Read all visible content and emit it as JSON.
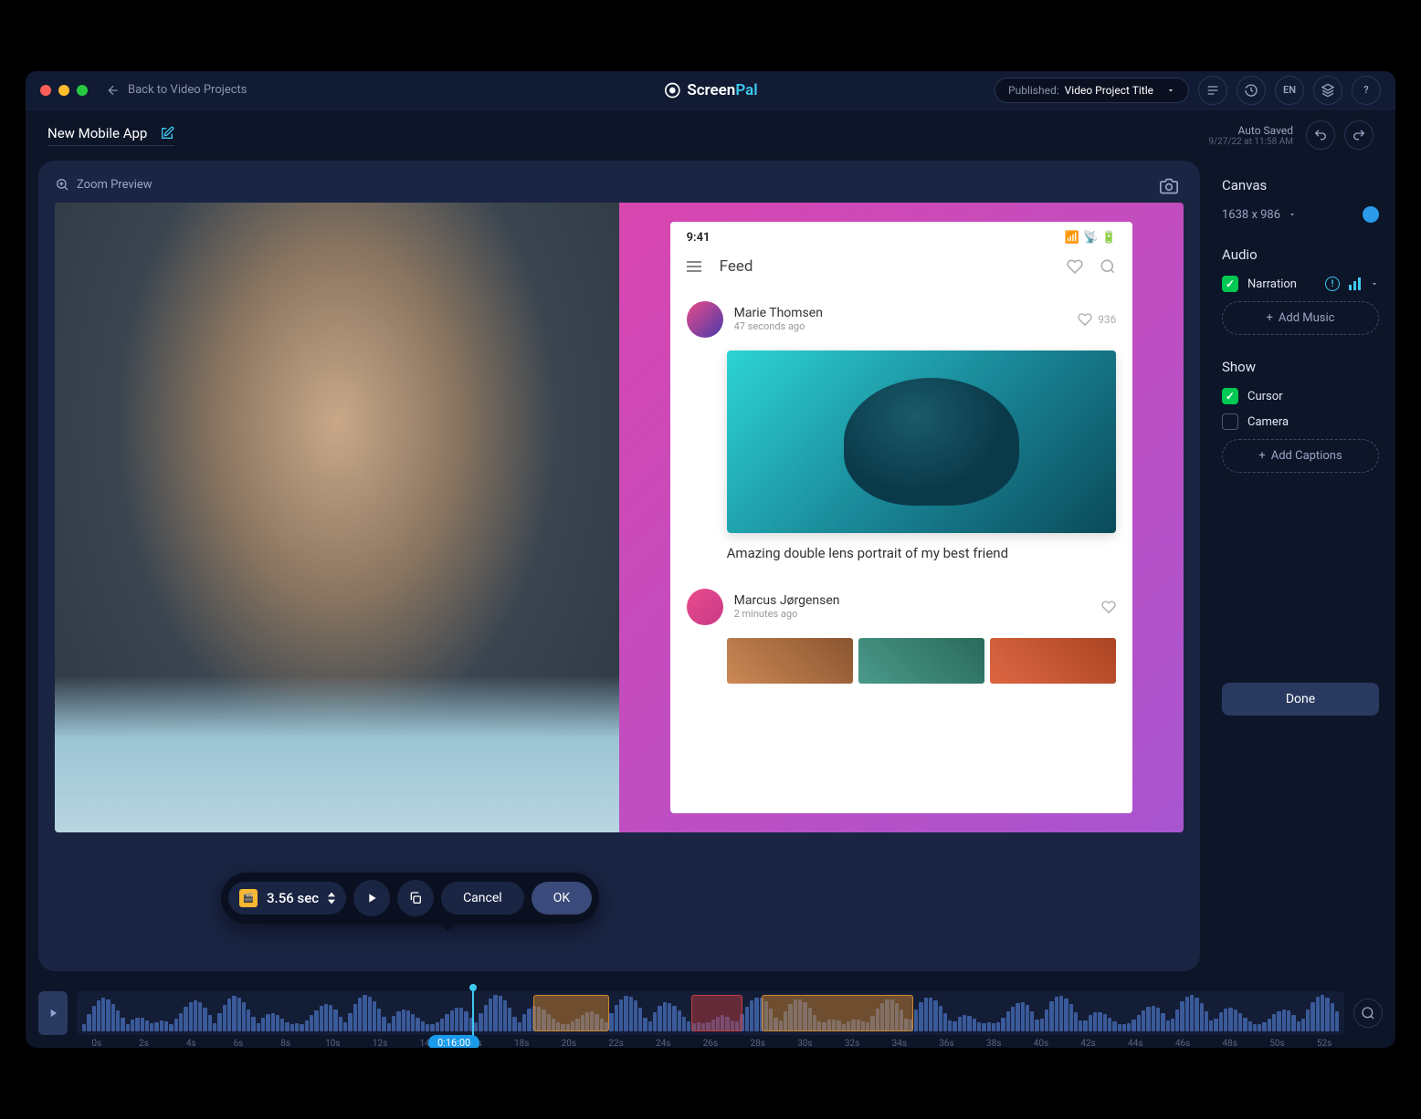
{
  "titlebar": {
    "back_label": "Back to Video Projects",
    "logo_screen": "Screen",
    "logo_pal": "Pal",
    "published_prefix": "Published",
    "published_title": "Video Project Title",
    "lang": "EN"
  },
  "subheader": {
    "project_title": "New Mobile App",
    "autosave_label": "Auto Saved",
    "autosave_time": "9/27/22 at 11:58 AM"
  },
  "editor": {
    "zoom_preview": "Zoom Preview",
    "phone": {
      "time": "9:41",
      "feed_title": "Feed",
      "post1_name": "Marie Thomsen",
      "post1_time": "47 seconds ago",
      "post1_likes": "936",
      "post1_caption": "Amazing double lens portrait of my best friend",
      "post2_name": "Marcus Jørgensen",
      "post2_time": "2 minutes ago"
    },
    "toolbar": {
      "duration": "3.56 sec",
      "cancel": "Cancel",
      "ok": "OK"
    }
  },
  "sidebar": {
    "canvas_title": "Canvas",
    "canvas_size": "1638 x 986",
    "audio_title": "Audio",
    "narration_label": "Narration",
    "add_music": "Add Music",
    "show_title": "Show",
    "cursor_label": "Cursor",
    "camera_label": "Camera",
    "add_captions": "Add Captions",
    "done": "Done"
  },
  "timeline": {
    "current_time": "0:16:00",
    "ticks": [
      "0s",
      "2s",
      "4s",
      "6s",
      "8s",
      "10s",
      "12s",
      "14s",
      "16s",
      "18s",
      "20s",
      "22s",
      "24s",
      "26s",
      "28s",
      "30s",
      "32s",
      "34s",
      "36s",
      "38s",
      "40s",
      "42s",
      "44s",
      "46s",
      "48s",
      "50s",
      "52s"
    ]
  }
}
